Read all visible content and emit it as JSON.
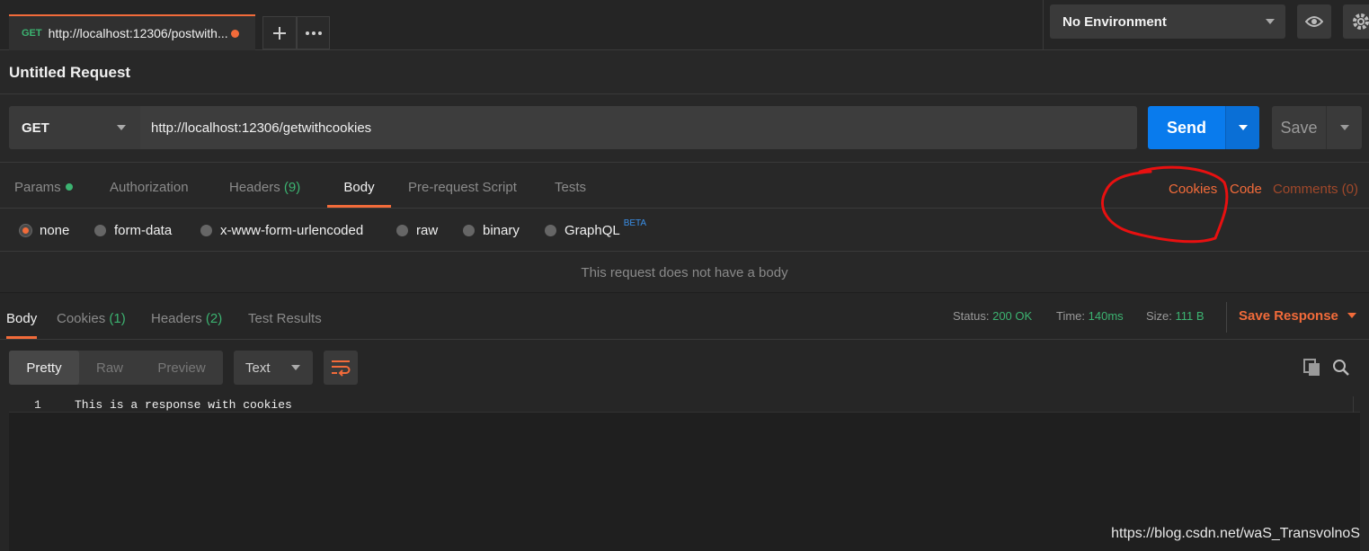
{
  "tab": {
    "method": "GET",
    "title": "http://localhost:12306/postwith..."
  },
  "environment": {
    "selected": "No Environment"
  },
  "request": {
    "title": "Untitled Request",
    "method": "GET",
    "url": "http://localhost:12306/getwithcookies",
    "send_label": "Send",
    "save_label": "Save"
  },
  "request_tabs": {
    "params": "Params",
    "authorization": "Authorization",
    "headers": "Headers",
    "headers_count": "(9)",
    "body": "Body",
    "prerequest": "Pre-request Script",
    "tests": "Tests",
    "cookies": "Cookies",
    "code": "Code",
    "comments": "Comments (0)"
  },
  "body_types": {
    "none": "none",
    "form_data": "form-data",
    "urlencoded": "x-www-form-urlencoded",
    "raw": "raw",
    "binary": "binary",
    "graphql": "GraphQL",
    "beta": "BETA",
    "selected": "none"
  },
  "no_body_message": "This request does not have a body",
  "response": {
    "tabs": {
      "body": "Body",
      "cookies": "Cookies",
      "cookies_count": "(1)",
      "headers": "Headers",
      "headers_count": "(2)",
      "test_results": "Test Results"
    },
    "status_label": "Status:",
    "status_value": "200 OK",
    "time_label": "Time:",
    "time_value": "140ms",
    "size_label": "Size:",
    "size_value": "111 B",
    "save_response": "Save Response",
    "view_modes": {
      "pretty": "Pretty",
      "raw": "Raw",
      "preview": "Preview"
    },
    "format": "Text",
    "lines": [
      {
        "number": "1",
        "text": "This is a response with cookies"
      }
    ]
  },
  "watermark": "https://blog.csdn.net/waS_TransvolnoS",
  "colors": {
    "accent": "#f26b3a",
    "send_blue": "#097bed",
    "success_green": "#3cb371",
    "annotation_red": "#e81010"
  },
  "icons": [
    "plus-icon",
    "more-icon",
    "eye-icon",
    "gear-icon",
    "wrap-icon",
    "copy-icon",
    "search-icon"
  ]
}
